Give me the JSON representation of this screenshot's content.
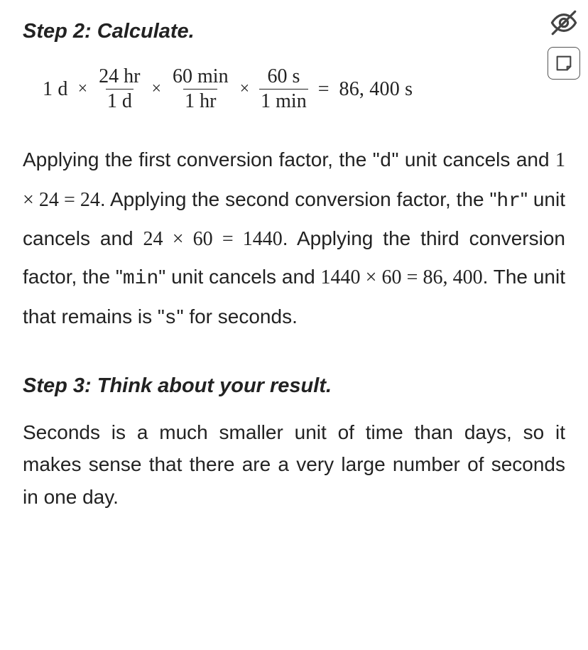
{
  "step2": {
    "title": "Step 2: Calculate.",
    "equation": {
      "lead": "1 d",
      "times": "×",
      "frac1_num": "24 hr",
      "frac1_den": "1 d",
      "frac2_num": "60 min",
      "frac2_den": "1 hr",
      "frac3_num": "60 s",
      "frac3_den": "1 min",
      "eq": "=",
      "result": "86, 400 s"
    },
    "explain": {
      "t1": "Applying the first conversion factor, the \"",
      "u1": "d",
      "t2": "\" unit cancels and ",
      "m1": "1 × 24 = 24",
      "t3": ". Applying the second conversion factor, the \"",
      "u2": "hr",
      "t4": "\" unit cancels and ",
      "m2": "24 × 60 = 1440",
      "t5": ". Applying the third conversion factor, the \"",
      "u3": "min",
      "t6": "\" unit cancels and ",
      "m3": "1440 × 60 = 86, 400",
      "t7": ". The unit that remains is \"",
      "u4": "s",
      "t8": "\" for seconds."
    }
  },
  "step3": {
    "title": "Step 3: Think about your result.",
    "text": "Seconds is a much smaller unit of time than days, so it makes sense that there are a very large number of seconds in one day."
  },
  "icons": {
    "hide": "hide-icon",
    "note": "note-icon"
  }
}
